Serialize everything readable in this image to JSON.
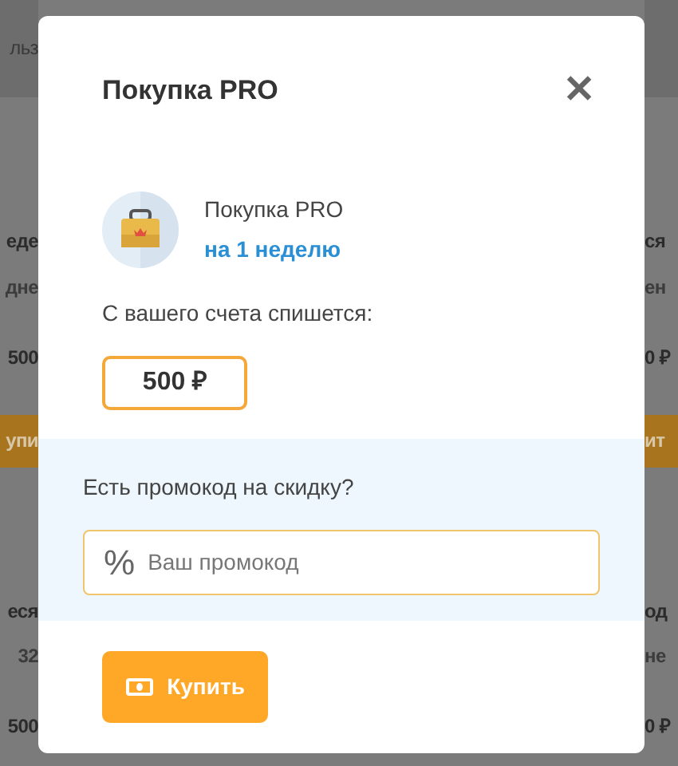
{
  "background": {
    "left": [
      {
        "kind": "header",
        "text": "льз"
      },
      {
        "kind": "title",
        "text": "еде"
      },
      {
        "kind": "sub",
        "text": "дне"
      },
      {
        "kind": "price",
        "text": "500"
      },
      {
        "kind": "button",
        "text": "упи"
      },
      {
        "kind": "title",
        "text": "еся"
      },
      {
        "kind": "sub",
        "text": "32"
      },
      {
        "kind": "price",
        "text": "500"
      }
    ],
    "right": [
      {
        "kind": "header"
      },
      {
        "kind": "title",
        "text": "ся"
      },
      {
        "kind": "sub",
        "text": "ен"
      },
      {
        "kind": "price",
        "text": "0 ₽"
      },
      {
        "kind": "button",
        "text": "ит"
      },
      {
        "kind": "title",
        "text": "од"
      },
      {
        "kind": "sub",
        "text": "не"
      },
      {
        "kind": "price",
        "text": "0 ₽"
      }
    ]
  },
  "modal": {
    "title": "Покупка PRO",
    "close": "✕",
    "product": {
      "name": "Покупка PRO",
      "period": "на 1 неделю"
    },
    "charge_label": "С вашего счета спишется:",
    "amount": "500 ₽",
    "promo": {
      "label": "Есть промокод на скидку?",
      "prefix": "%",
      "placeholder": "Ваш промокод"
    },
    "buy_button": "Купить"
  }
}
